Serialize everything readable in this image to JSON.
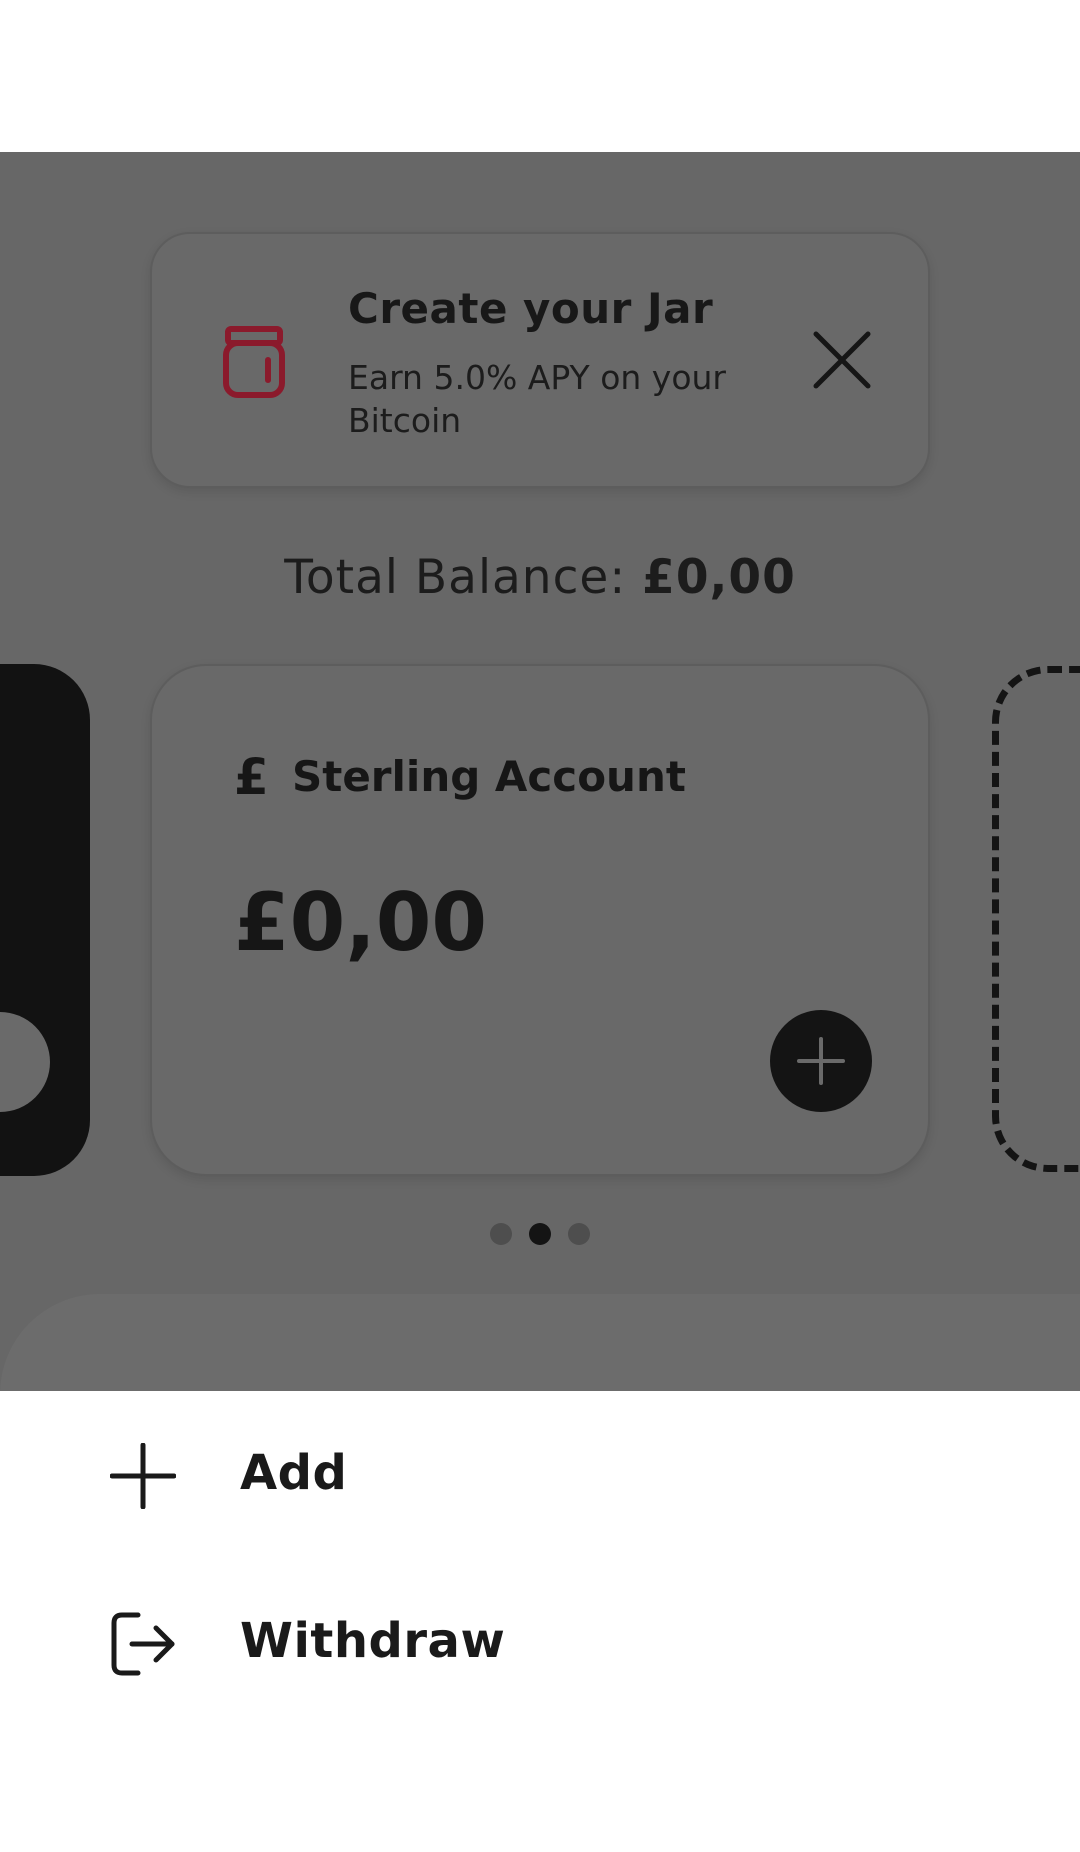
{
  "promo": {
    "title": "Create your Jar",
    "subtitle": "Earn 5.0% APY on your Bitcoin",
    "icon": "jar-icon",
    "close_icon": "close-icon",
    "accent_color": "#8b1a2c"
  },
  "balance": {
    "label": "Total Balance: ",
    "amount": "£0,00"
  },
  "account": {
    "symbol": "£",
    "name": "Sterling Account",
    "amount": "£0,00",
    "add_icon": "plus-icon"
  },
  "carousel": {
    "page_count": 3,
    "active_index": 1
  },
  "actions": [
    {
      "label": "Add",
      "icon": "plus-icon"
    },
    {
      "label": "Withdraw",
      "icon": "withdraw-icon"
    }
  ]
}
